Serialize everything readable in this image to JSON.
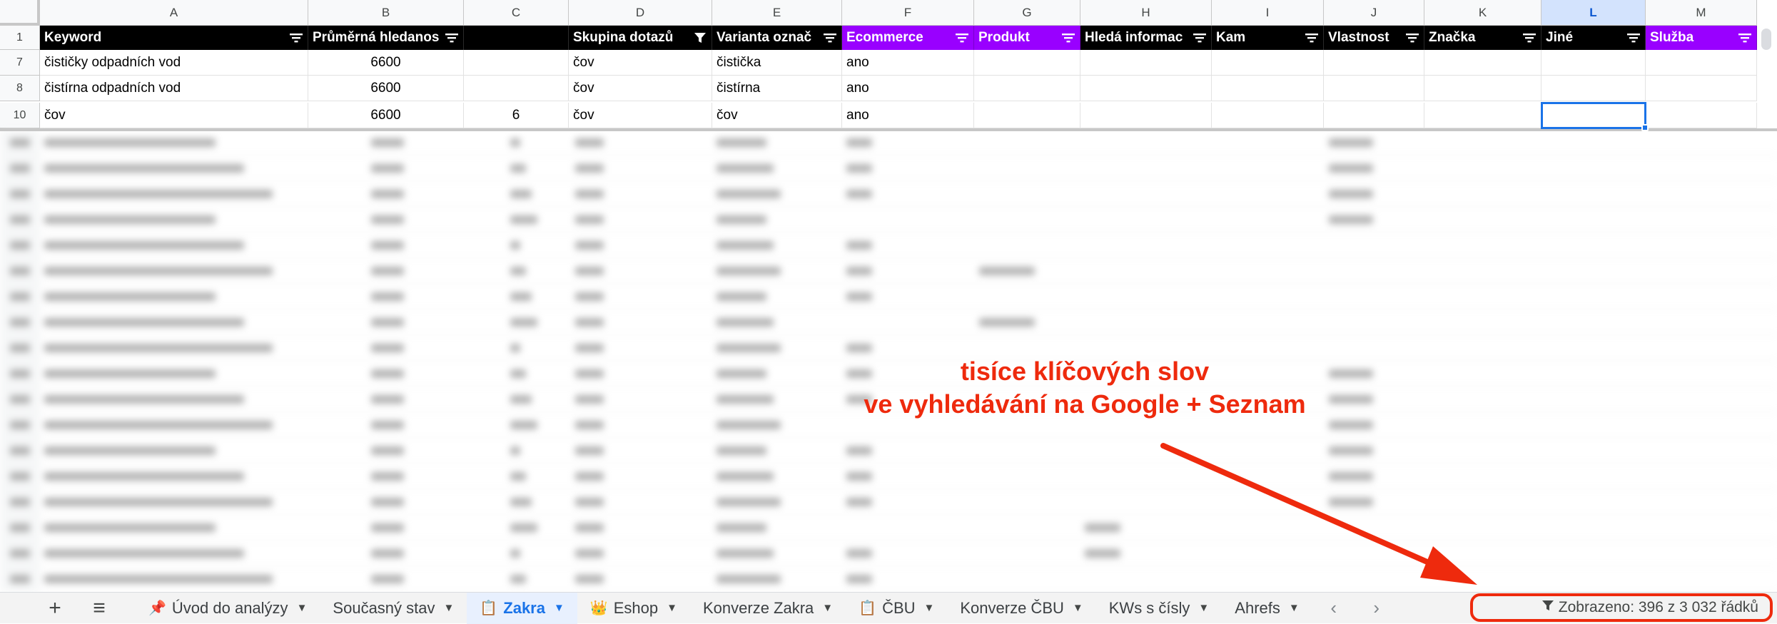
{
  "columns": [
    "A",
    "B",
    "C",
    "D",
    "E",
    "F",
    "G",
    "H",
    "I",
    "J",
    "K",
    "L",
    "M"
  ],
  "selected_column": "L",
  "header_row_number": "1",
  "headers": [
    {
      "col": "A",
      "label": "Keyword",
      "style": "black"
    },
    {
      "col": "B",
      "label": "Průměrná hledanos",
      "style": "black"
    },
    {
      "col": "C",
      "label": "",
      "style": "black"
    },
    {
      "col": "D",
      "label": "Skupina dotazů",
      "style": "black",
      "filter_active": true
    },
    {
      "col": "E",
      "label": "Varianta označ",
      "style": "black"
    },
    {
      "col": "F",
      "label": "Ecommerce",
      "style": "purple"
    },
    {
      "col": "G",
      "label": "Produkt",
      "style": "purple"
    },
    {
      "col": "H",
      "label": "Hledá informac",
      "style": "black"
    },
    {
      "col": "I",
      "label": "Kam",
      "style": "black"
    },
    {
      "col": "J",
      "label": "Vlastnost",
      "style": "black"
    },
    {
      "col": "K",
      "label": "Značka",
      "style": "black"
    },
    {
      "col": "L",
      "label": "Jiné",
      "style": "black"
    },
    {
      "col": "M",
      "label": "Služba",
      "style": "purple"
    }
  ],
  "rows": [
    {
      "num": "7",
      "cells": [
        "čističky odpadních vod",
        "6600",
        "",
        "čov",
        "čistička",
        "ano",
        "",
        "",
        "",
        "",
        "",
        "",
        ""
      ]
    },
    {
      "num": "8",
      "cells": [
        "čistírna odpadních vod",
        "6600",
        "",
        "čov",
        "čistírna",
        "ano",
        "",
        "",
        "",
        "",
        "",
        "",
        ""
      ]
    },
    {
      "num": "10",
      "cells": [
        "čov",
        "6600",
        "6",
        "čov",
        "čov",
        "ano",
        "",
        "",
        "",
        "",
        "",
        "",
        ""
      ]
    }
  ],
  "annotation": {
    "line1": "tisíce klíčových slov",
    "line2": "ve vyhledávání na Google + Seznam",
    "color": "#ee2a0d"
  },
  "tabs": [
    {
      "icon": "📌",
      "label": "Úvod do analýzy",
      "active": false
    },
    {
      "icon": "",
      "label": "Současný stav",
      "active": false
    },
    {
      "icon": "📋",
      "label": "Zakra",
      "active": true
    },
    {
      "icon": "👑",
      "label": "Eshop",
      "active": false
    },
    {
      "icon": "",
      "label": "Konverze Zakra",
      "active": false
    },
    {
      "icon": "📋",
      "label": "ČBU",
      "active": false
    },
    {
      "icon": "",
      "label": "Konverze ČBU",
      "active": false
    },
    {
      "icon": "",
      "label": "KWs s čísly",
      "active": false
    },
    {
      "icon": "",
      "label": "Ahrefs",
      "active": false
    }
  ],
  "bottom_buttons": {
    "add": "+",
    "menu": "≡",
    "prev": "‹",
    "next": "›"
  },
  "status_text": "Zobrazeno: 396 z 3 032 řádků",
  "colors": {
    "header_black": "#000000",
    "header_purple": "#9900ff",
    "selection": "#1a73e8",
    "active_tab_bg": "#e8f0fe"
  }
}
